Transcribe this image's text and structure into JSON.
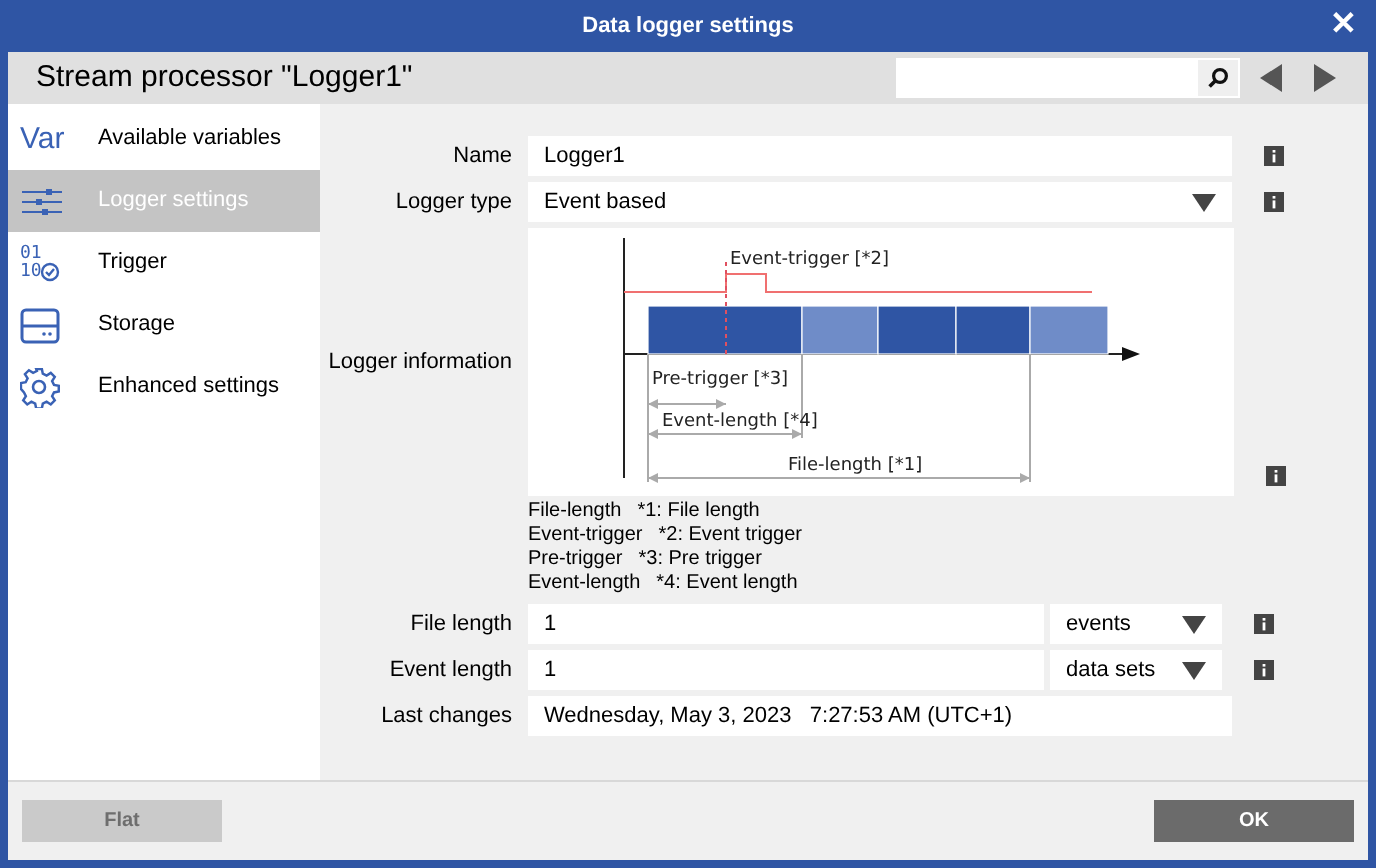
{
  "window": {
    "title": "Data logger settings",
    "close": "✕"
  },
  "header": {
    "title": "Stream processor \"Logger1\""
  },
  "sidebar": {
    "items": [
      {
        "kind": "var",
        "icon_text": "Var",
        "label": "Available variables",
        "selected": false
      },
      {
        "kind": "sliders",
        "label": "Logger settings",
        "selected": true
      },
      {
        "kind": "binary",
        "icon_text": "01 10",
        "label": "Trigger",
        "selected": false
      },
      {
        "kind": "storage",
        "label": "Storage",
        "selected": false
      },
      {
        "kind": "gear",
        "label": "Enhanced settings",
        "selected": false
      }
    ]
  },
  "form": {
    "name": {
      "label": "Name",
      "value": "Logger1"
    },
    "logger_type": {
      "label": "Logger type",
      "value": "Event based"
    },
    "logger_information": {
      "label": "Logger information",
      "diagram_labels": {
        "event_trigger": "Event-trigger [*2]",
        "pre_trigger": "Pre-trigger [*3]",
        "event_length": "Event-length [*4]",
        "file_length": "File-length [*1]"
      },
      "segments": [
        {
          "kind": "dark"
        },
        {
          "kind": "light"
        },
        {
          "kind": "dark"
        },
        {
          "kind": "dark"
        },
        {
          "kind": "light"
        }
      ]
    },
    "legend": [
      {
        "term": "File-length",
        "desc": "*1: File length"
      },
      {
        "term": "Event-trigger",
        "desc": "*2: Event trigger"
      },
      {
        "term": "Pre-trigger",
        "desc": "*3: Pre trigger"
      },
      {
        "term": "Event-length",
        "desc": "*4: Event length"
      }
    ],
    "file_length": {
      "label": "File length",
      "value": "1",
      "unit": "events"
    },
    "event_length": {
      "label": "Event length",
      "value": "1",
      "unit": "data sets"
    },
    "last_changes": {
      "label": "Last changes",
      "value": "Wednesday, May 3, 2023   7:27:53 AM (UTC+1)"
    }
  },
  "footer": {
    "buttons": [
      {
        "label": "Flat",
        "disabled": true
      },
      {
        "label": "OK",
        "disabled": false
      }
    ]
  }
}
